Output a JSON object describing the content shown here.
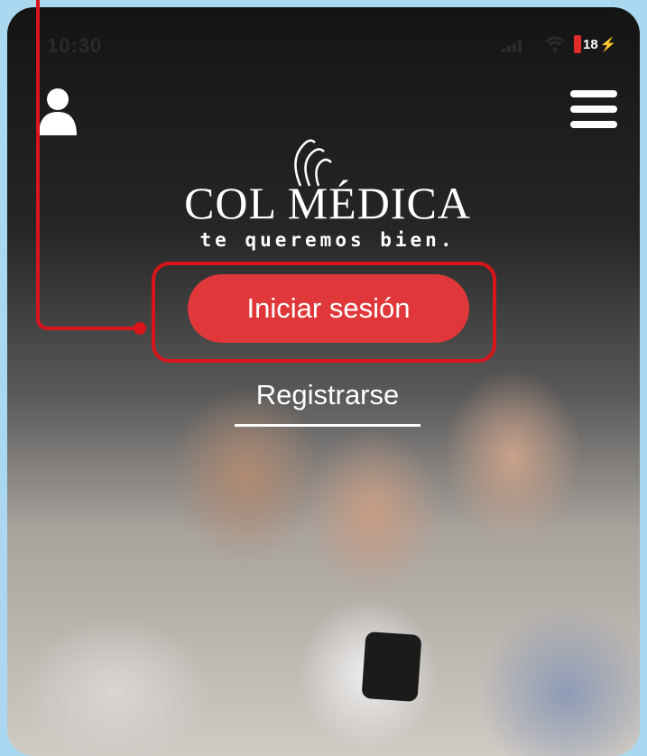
{
  "status_bar": {
    "time": "10:30",
    "battery": "18"
  },
  "header": {
    "user_icon": "user-icon",
    "menu_icon": "hamburger-menu-icon"
  },
  "logo": {
    "brand": "COL MÉDICA",
    "tagline": "te queremos bien."
  },
  "actions": {
    "login_label": "Iniciar sesión",
    "register_label": "Registrarse"
  },
  "colors": {
    "accent": "#e0383a",
    "annotation": "#d9141b",
    "frame": "#a9d8f0"
  }
}
